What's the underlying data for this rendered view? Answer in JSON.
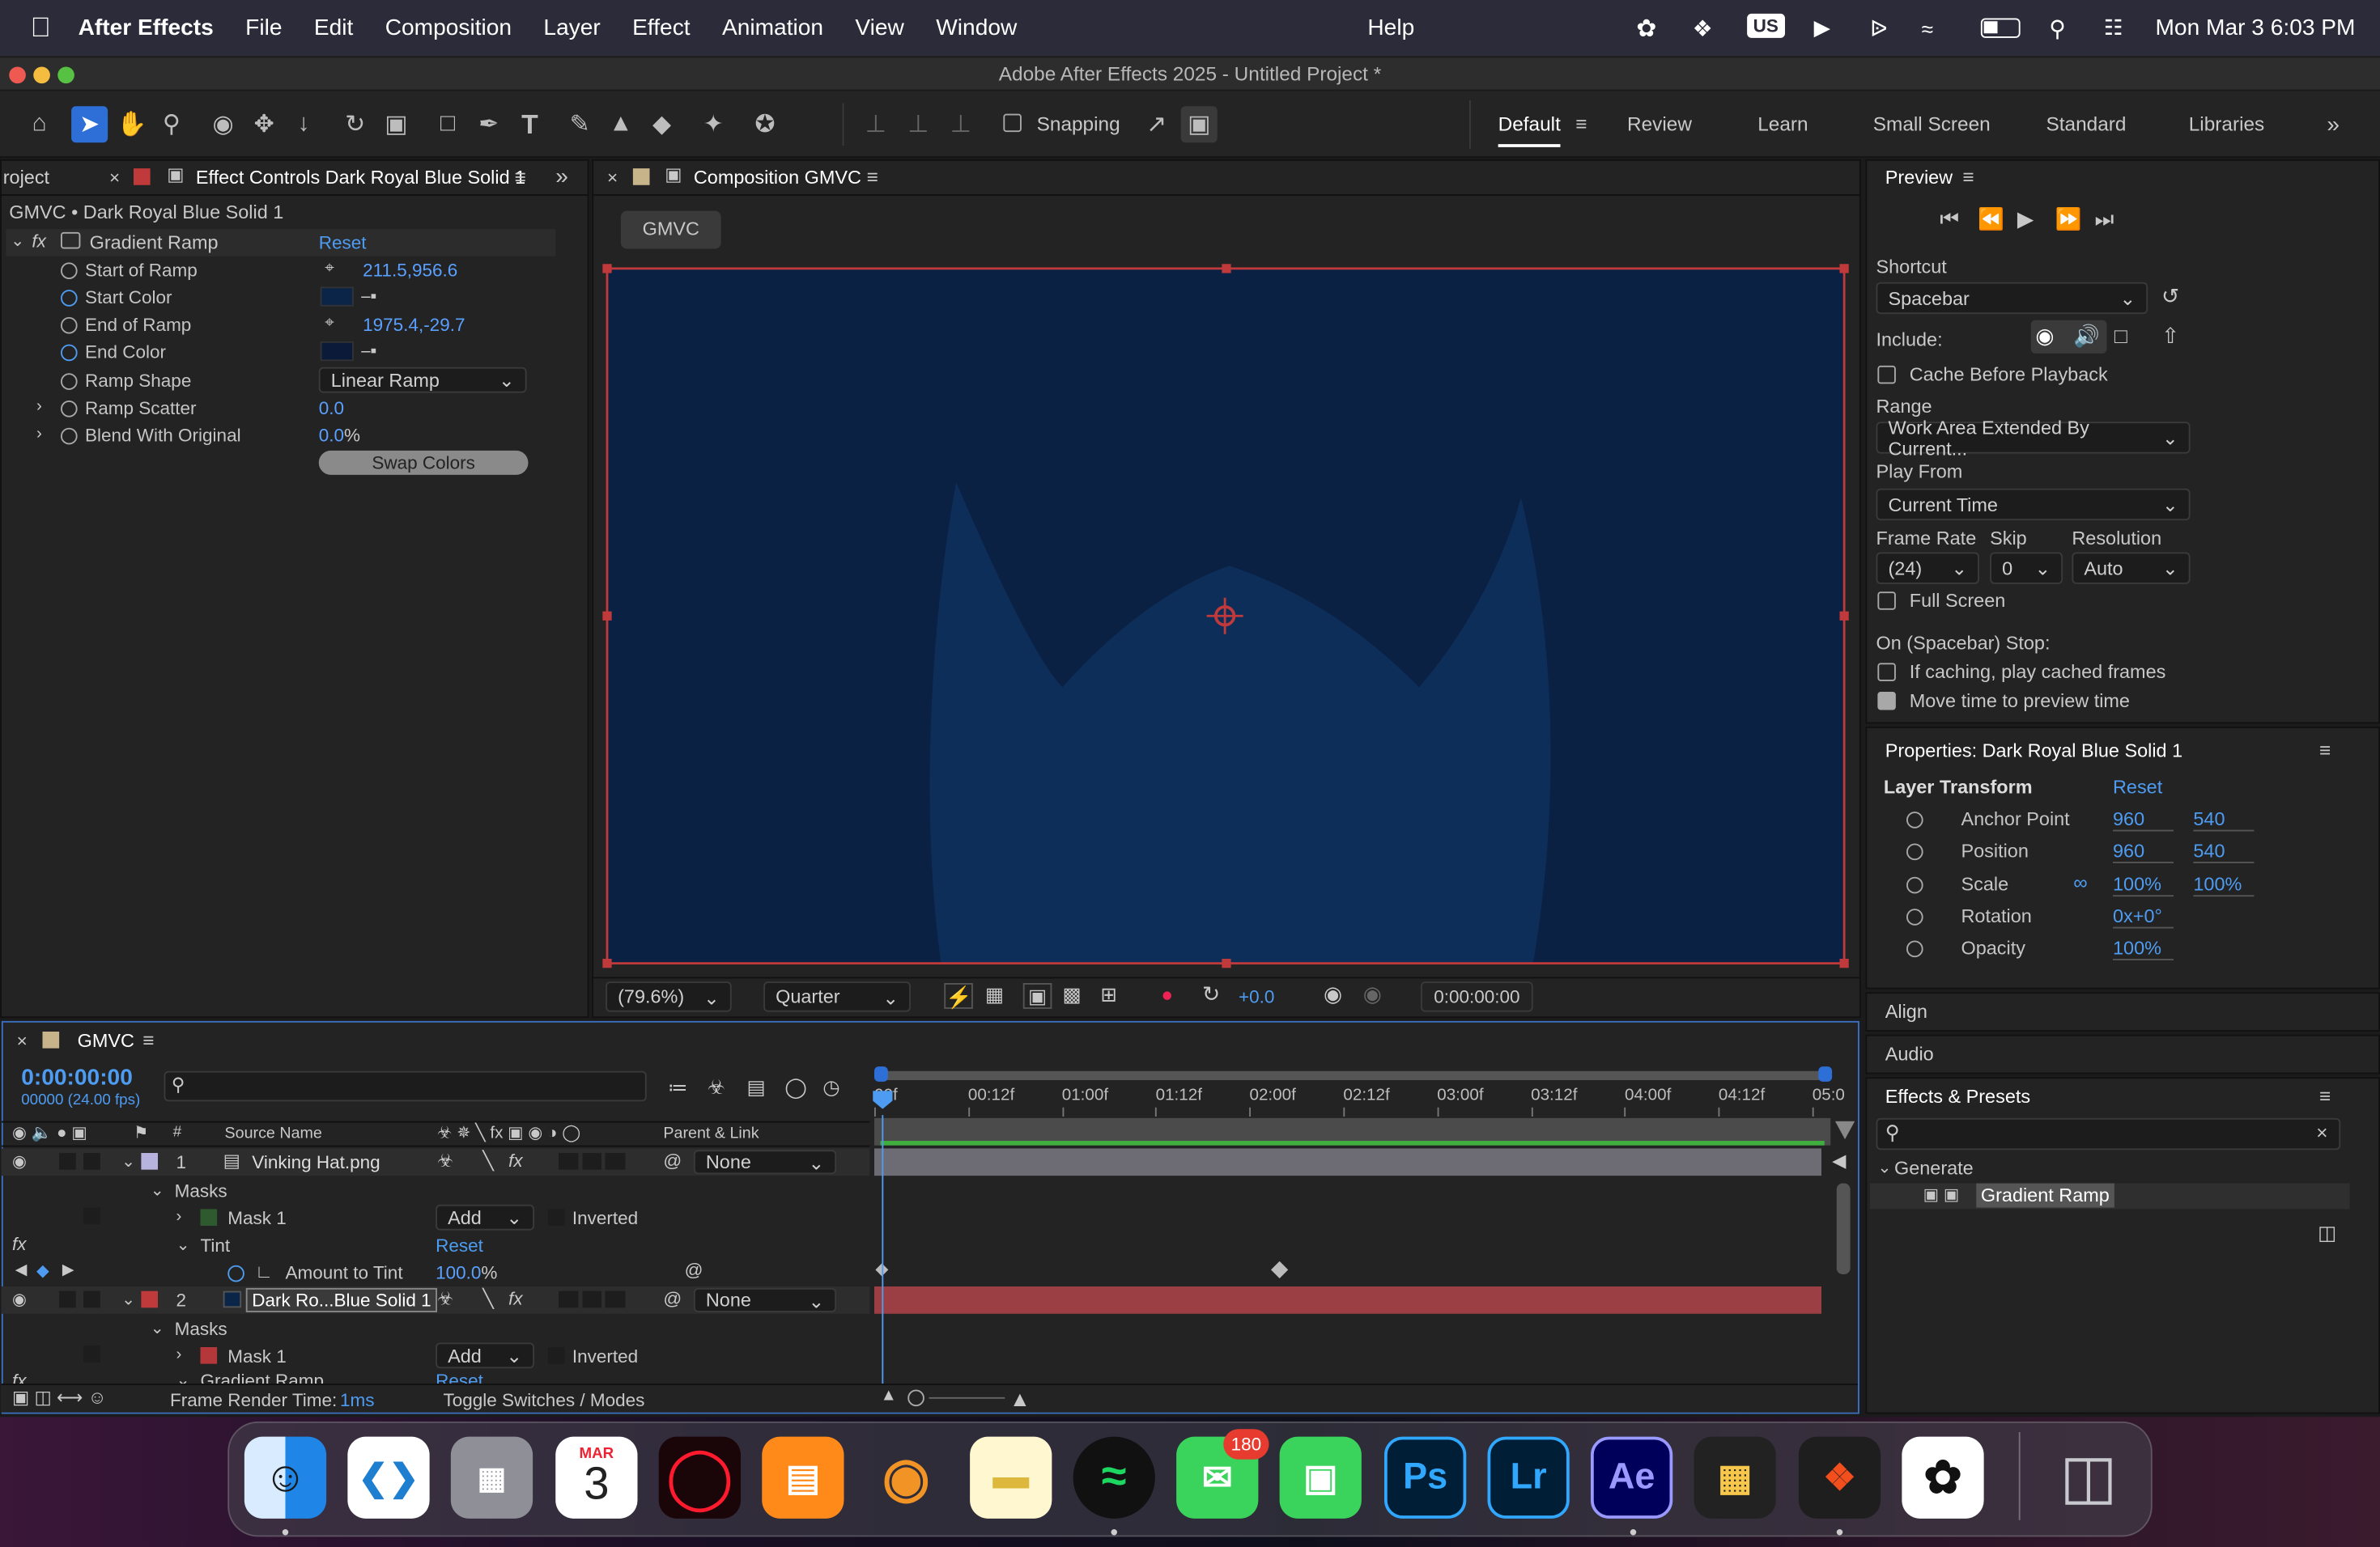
{
  "menubar": {
    "app": "After Effects",
    "items": [
      "File",
      "Edit",
      "Composition",
      "Layer",
      "Effect",
      "Animation",
      "View",
      "Window"
    ],
    "help": "Help",
    "input": "US",
    "clock": "Mon Mar 3  6:03 PM"
  },
  "title": "Adobe After Effects 2025 - Untitled Project *",
  "toolbar": {
    "snapping": "Snapping",
    "workspaces": [
      "Default",
      "Review",
      "Learn",
      "Small Screen",
      "Standard",
      "Libraries"
    ]
  },
  "effect_panel": {
    "project_tab": "roject",
    "tab": "Effect Controls Dark Royal Blue Solid 1",
    "breadcrumb": "GMVC • Dark Royal Blue Solid 1",
    "effect_name": "Gradient Ramp",
    "reset": "Reset",
    "props": [
      {
        "name": "Start of Ramp",
        "value": "211.5,956.6"
      },
      {
        "name": "Start Color",
        "value": ""
      },
      {
        "name": "End of Ramp",
        "value": "1975.4,-29.7"
      },
      {
        "name": "End Color",
        "value": ""
      },
      {
        "name": "Ramp Shape",
        "value": "Linear Ramp"
      },
      {
        "name": "Ramp Scatter",
        "value": "0.0"
      },
      {
        "name": "Blend With Original",
        "value": "0.0",
        "unit": "%"
      }
    ],
    "swap": "Swap Colors"
  },
  "comp": {
    "tab": "Composition GMVC",
    "chip": "GMVC",
    "zoom": "(79.6%)",
    "resolution": "Quarter",
    "exposure": "+0.0",
    "timecode": "0:00:00:00"
  },
  "preview": {
    "title": "Preview",
    "shortcut_label": "Shortcut",
    "shortcut": "Spacebar",
    "include": "Include:",
    "cache": "Cache Before Playback",
    "range_label": "Range",
    "range": "Work Area Extended By Current...",
    "playfrom_label": "Play From",
    "playfrom": "Current Time",
    "framerate_label": "Frame Rate",
    "skip_label": "Skip",
    "resolution_label": "Resolution",
    "framerate": "(24)",
    "skip": "0",
    "resolution": "Auto",
    "fullscreen": "Full Screen",
    "stop_label": "On (Spacebar) Stop:",
    "ifcaching": "If caching, play cached frames",
    "movetime": "Move time to preview time"
  },
  "properties": {
    "title": "Properties: Dark Royal Blue Solid 1",
    "section": "Layer Transform",
    "reset": "Reset",
    "rows": [
      {
        "name": "Anchor Point",
        "v1": "960",
        "v2": "540"
      },
      {
        "name": "Position",
        "v1": "960",
        "v2": "540"
      },
      {
        "name": "Scale",
        "v1": "100%",
        "v2": "100%"
      },
      {
        "name": "Rotation",
        "v1": "0x+0°",
        "v2": ""
      },
      {
        "name": "Opacity",
        "v1": "100%",
        "v2": ""
      }
    ]
  },
  "side_tabs": {
    "align": "Align",
    "audio": "Audio",
    "effects": "Effects & Presets",
    "generate": "Generate",
    "gradient": "Gradient Ramp"
  },
  "timeline": {
    "tab": "GMVC",
    "timecode": "0:00:00:00",
    "fps": "00000 (24.00 fps)",
    "col_source": "Source Name",
    "col_parent": "Parent & Link",
    "col_num": "#",
    "ruler": [
      "00f",
      "00:12f",
      "01:00f",
      "01:12f",
      "02:00f",
      "02:12f",
      "03:00f",
      "03:12f",
      "04:00f",
      "04:12f",
      "05:0"
    ],
    "layer1": {
      "num": "1",
      "name": "Vinking Hat.png",
      "parent": "None"
    },
    "masks": "Masks",
    "mask1": "Mask 1",
    "mode": "Add",
    "inverted": "Inverted",
    "tint": "Tint",
    "tint_reset": "Reset",
    "amount": "Amount to Tint",
    "amount_val": "100.0",
    "amount_unit": "%",
    "layer2": {
      "num": "2",
      "name": "Dark Ro...Blue Solid 1",
      "parent": "None"
    },
    "gradient": "Gradient Ramp",
    "gradient_reset": "Reset",
    "render_label": "Frame Render Time:",
    "render_val": "1ms",
    "toggle": "Toggle Switches / Modes"
  },
  "dock": {
    "calendar_month": "MAR",
    "calendar_day": "3",
    "messages_badge": "180"
  }
}
